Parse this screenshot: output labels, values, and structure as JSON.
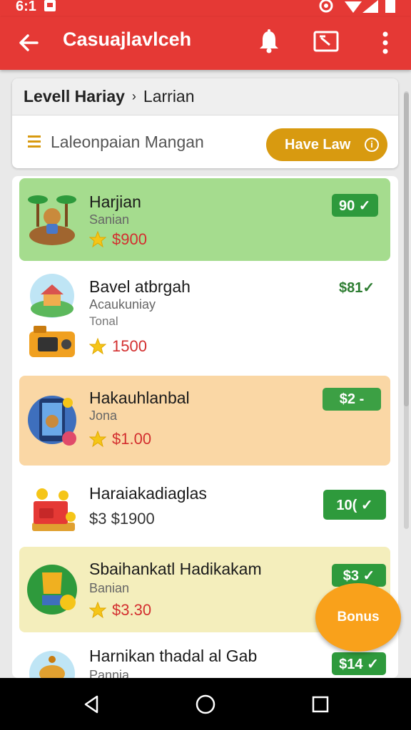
{
  "status": {
    "time": "6:1"
  },
  "appbar": {
    "title": "Casuajlavlceh"
  },
  "breadcrumb": {
    "level": "Levell Hariay",
    "separator": "›",
    "current": "Larrian"
  },
  "filter": {
    "text": "Laleonpaian Mangan",
    "button_label": "Have Law",
    "info_glyph": "i"
  },
  "items": [
    {
      "title": "Harjian",
      "subtitle": "Sanian",
      "reward": "$900",
      "badge": "90 ✓",
      "bg": "#a5dc8e",
      "badge_bg": "#2e9a3c"
    },
    {
      "title": "Bavel atbrgah",
      "subtitle": "Acaukuniay",
      "subtitle2": "Tonal",
      "reward": "1500",
      "badge": "$81✓",
      "bg": "#ffffff",
      "badge_bg": "transparent"
    },
    {
      "title": "Hakauhlanbal",
      "subtitle": "Jona",
      "reward": "$1.00",
      "badge": "$2 -",
      "bg": "#fad7a5",
      "badge_bg": "#3ca044"
    },
    {
      "title": "Haraiakadiaglas",
      "subtitle": "",
      "reward": "$3 $1900",
      "badge": "10( ✓",
      "bg": "#ffffff",
      "badge_bg": "#2e9a3c"
    },
    {
      "title": "Sbaihankatl Hadikakam",
      "subtitle": "Banian",
      "reward": "$3.30",
      "badge": "$3 ✓",
      "bg": "#f4eebc",
      "badge_bg": "#2e9a3c"
    },
    {
      "title": "Harnikan thadal al Gab",
      "subtitle": "Pannia",
      "reward": "",
      "badge": "$14 ✓",
      "bg": "#ffffff",
      "badge_bg": "#2e9a3c"
    }
  ],
  "fab": {
    "label": "Bonus"
  },
  "colors": {
    "appbar": "#e53935",
    "accent_button": "#d89a10",
    "reward_red": "#d32f2f",
    "badge_green": "#2e9a3c",
    "fab": "#f9a11b"
  },
  "icons": [
    "back-arrow-icon",
    "bell-icon",
    "tv-icon",
    "more-vert-icon",
    "menu-icon",
    "info-icon",
    "star-icon",
    "nav-back-icon",
    "nav-home-icon",
    "nav-recents-icon"
  ]
}
